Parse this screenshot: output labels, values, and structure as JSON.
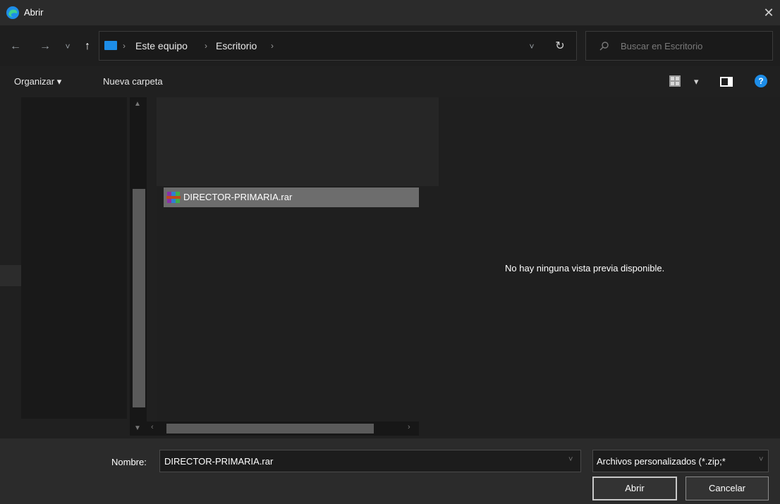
{
  "window": {
    "title": "Abrir",
    "close_glyph": "✕"
  },
  "nav": {
    "back_glyph": "←",
    "forward_glyph": "→",
    "recent_glyph": "˅",
    "up_glyph": "↑",
    "breadcrumbs": [
      "Este equipo",
      "Escritorio"
    ],
    "crumb_sep": "›",
    "dropdown_glyph": "˅",
    "refresh_glyph": "↻"
  },
  "search": {
    "placeholder": "Buscar en Escritorio",
    "icon": "search-icon"
  },
  "toolbar": {
    "organize_label": "Organizar ▾",
    "new_folder_label": "Nueva carpeta",
    "view_dropdown_glyph": "▾",
    "help_glyph": "?"
  },
  "files": [
    {
      "name": "DIRECTOR-PRIMARIA.rar",
      "icon": "rar-archive-icon",
      "selected": true
    }
  ],
  "preview": {
    "message": "No hay ninguna vista previa disponible."
  },
  "footer": {
    "name_label": "Nombre:",
    "name_value": "DIRECTOR-PRIMARIA.rar",
    "filetype_value": "Archivos personalizados (*.zip;*",
    "open_label": "Abrir",
    "cancel_label": "Cancelar"
  },
  "colors": {
    "accent": "#1d8de8",
    "background": "#202020",
    "selection": "#6d6d6d"
  }
}
